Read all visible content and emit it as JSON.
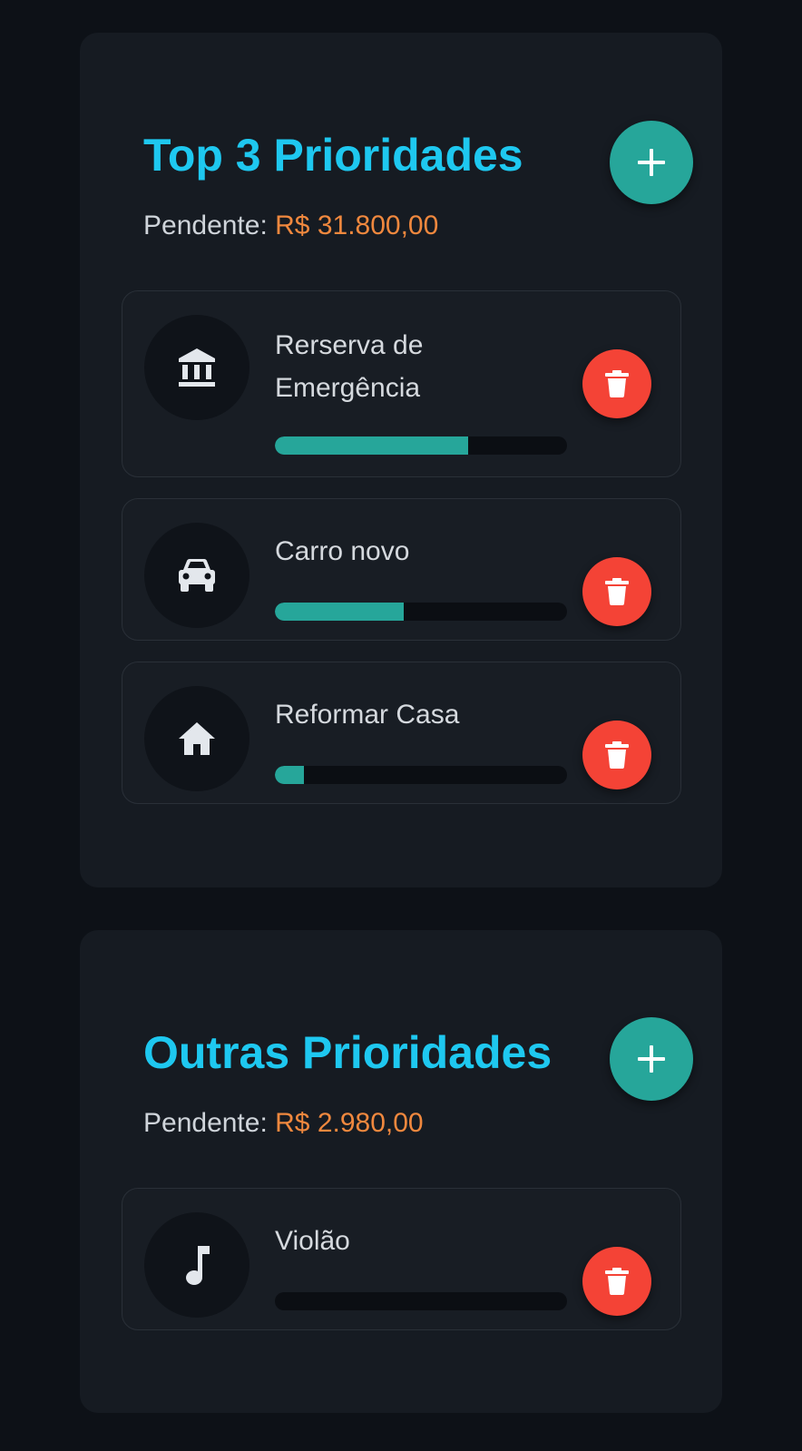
{
  "colors": {
    "accent_title": "#1ec8f0",
    "pending_value": "#f0883e",
    "add_button": "#26a69a",
    "delete_button": "#f44336",
    "progress_fill": "#26a69a"
  },
  "top": {
    "title": "Top 3 Prioridades",
    "pending_label": "Pendente:",
    "pending_value": "R$ 31.800,00",
    "add_icon": "plus-icon",
    "items": [
      {
        "name": "Rerserva de Emergência",
        "icon": "bank-icon",
        "progress": 0.66,
        "delete_icon": "trash-icon"
      },
      {
        "name": "Carro novo",
        "icon": "car-icon",
        "progress": 0.44,
        "delete_icon": "trash-icon"
      },
      {
        "name": "Reformar Casa",
        "icon": "home-icon",
        "progress": 0.1,
        "delete_icon": "trash-icon"
      }
    ]
  },
  "other": {
    "title": "Outras Prioridades",
    "pending_label": "Pendente:",
    "pending_value": "R$ 2.980,00",
    "add_icon": "plus-icon",
    "items": [
      {
        "name": "Violão",
        "icon": "music-note-icon",
        "progress": 0,
        "delete_icon": "trash-icon"
      }
    ]
  }
}
